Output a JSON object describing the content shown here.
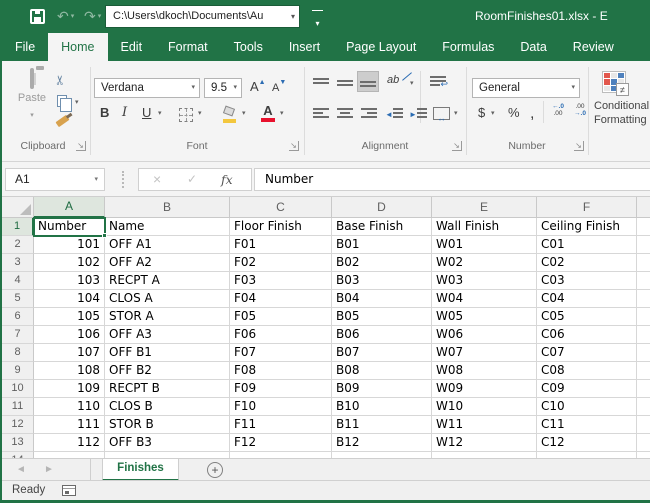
{
  "window": {
    "title": "RoomFinishes01.xlsx - E",
    "path": "C:\\Users\\dkoch\\Documents\\Au"
  },
  "ribbon_tabs": [
    "File",
    "Home",
    "Edit",
    "Format",
    "Tools",
    "Insert",
    "Page Layout",
    "Formulas",
    "Data",
    "Review"
  ],
  "active_tab": "Home",
  "ribbon": {
    "clipboard": {
      "label": "Clipboard",
      "paste": "Paste"
    },
    "font": {
      "label": "Font",
      "family": "Verdana",
      "size": "9.5",
      "bold": "B",
      "italic": "I",
      "underline": "U",
      "grow": "A",
      "shrink": "A",
      "color_letter": "A"
    },
    "alignment": {
      "label": "Alignment",
      "orientation": "ab"
    },
    "number": {
      "label": "Number",
      "format": "General",
      "currency": "$",
      "percent": "%",
      "comma": ",",
      "inc_top": "←.0",
      "inc_bottom": ".00",
      "dec_top": ".00",
      "dec_bottom": "→.0"
    },
    "conditional": {
      "line1": "Conditional",
      "line2": "Formatting",
      "badge": "≠"
    }
  },
  "formula_bar": {
    "name_box": "A1",
    "cancel": "×",
    "enter": "✓",
    "fx": "fx",
    "value": "Number"
  },
  "grid": {
    "col_letters": [
      "A",
      "B",
      "C",
      "D",
      "E",
      "F"
    ],
    "selected_cell": "A1",
    "rows": [
      [
        "Number",
        "Name",
        "Floor Finish",
        "Base Finish",
        "Wall Finish",
        "Ceiling Finish"
      ],
      [
        "101",
        "OFF A1",
        "F01",
        "B01",
        "W01",
        "C01"
      ],
      [
        "102",
        "OFF A2",
        "F02",
        "B02",
        "W02",
        "C02"
      ],
      [
        "103",
        "RECPT A",
        "F03",
        "B03",
        "W03",
        "C03"
      ],
      [
        "104",
        "CLOS A",
        "F04",
        "B04",
        "W04",
        "C04"
      ],
      [
        "105",
        "STOR A",
        "F05",
        "B05",
        "W05",
        "C05"
      ],
      [
        "106",
        "OFF A3",
        "F06",
        "B06",
        "W06",
        "C06"
      ],
      [
        "107",
        "OFF B1",
        "F07",
        "B07",
        "W07",
        "C07"
      ],
      [
        "108",
        "OFF B2",
        "F08",
        "B08",
        "W08",
        "C08"
      ],
      [
        "109",
        "RECPT B",
        "F09",
        "B09",
        "W09",
        "C09"
      ],
      [
        "110",
        "CLOS B",
        "F10",
        "B10",
        "W10",
        "C10"
      ],
      [
        "111",
        "STOR B",
        "F11",
        "B11",
        "W11",
        "C11"
      ],
      [
        "112",
        "OFF B3",
        "F12",
        "B12",
        "W12",
        "C12"
      ],
      [
        "",
        "",
        "",
        "",
        "",
        ""
      ]
    ]
  },
  "sheet_bar": {
    "active_tab": "Finishes",
    "add": "+",
    "prev": "◄",
    "next": "►"
  },
  "status_bar": {
    "mode": "Ready"
  },
  "icons": {
    "undo": "↶",
    "redo": "↷",
    "dropdown": "▾",
    "cut": "✂",
    "wrap_return": "↩",
    "merge": "↔",
    "grow_caret": "▲",
    "shrink_caret": "▼",
    "indent_left": "◄",
    "indent_right": "►"
  },
  "colors": {
    "accent_green": "#217346",
    "font_color_red": "#e8112d",
    "fill_yellow": "#f3c73e",
    "cf_red": "#e2574c",
    "cf_blue": "#4f81bd"
  }
}
